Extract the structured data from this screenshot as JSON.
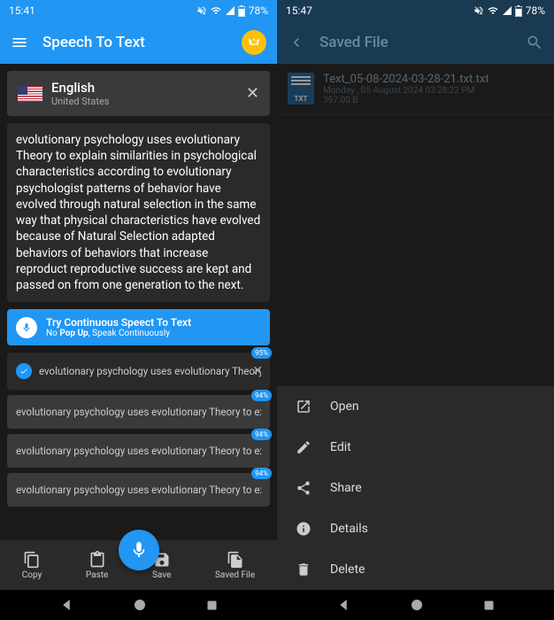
{
  "left": {
    "status": {
      "time": "15:41",
      "battery": "78%"
    },
    "app_title": "Speech To Text",
    "language": {
      "name": "English",
      "region": "United States"
    },
    "transcript": "evolutionary psychology uses evolutionary Theory to explain similarities in psychological characteristics according to evolutionary psychologist patterns of behavior have evolved through natural selection in the same way that physical characteristics have evolved because of Natural Selection adapted behaviors of behaviors that increase reproduct reproductive success are kept and passed on from one generation to the next.",
    "continuous": {
      "title": "Try Continuous Speect To Text",
      "sub_prefix": "No ",
      "sub_bold": "Pop Up",
      "sub_suffix": ", Speak Continuously"
    },
    "history": [
      {
        "text": "evolutionary psychology uses evolutionary Theory to exp",
        "badge": "95%",
        "selected": true,
        "show_close": true
      },
      {
        "text": "evolutionary psychology uses evolutionary Theory to explain",
        "badge": "94%",
        "selected": false,
        "show_close": false
      },
      {
        "text": "evolutionary psychology uses evolutionary Theory to explain",
        "badge": "94%",
        "selected": false,
        "show_close": false
      },
      {
        "text": "evolutionary psychology uses evolutionary Theory to explain",
        "badge": "94%",
        "selected": false,
        "show_close": false
      }
    ],
    "bottom": {
      "copy": "Copy",
      "paste": "Paste",
      "save": "Save",
      "saved_file": "Saved File"
    }
  },
  "right": {
    "status": {
      "time": "15:47",
      "battery": "78%"
    },
    "app_title": "Saved File",
    "file": {
      "name": "Text_05-08-2024-03-28-21.txt.txt",
      "date": "Monday , 05 August 2024 03:28:22 PM",
      "size": "397.00 B",
      "icon_label": "TXT"
    },
    "actions": {
      "open": "Open",
      "edit": "Edit",
      "share": "Share",
      "details": "Details",
      "delete": "Delete"
    }
  }
}
